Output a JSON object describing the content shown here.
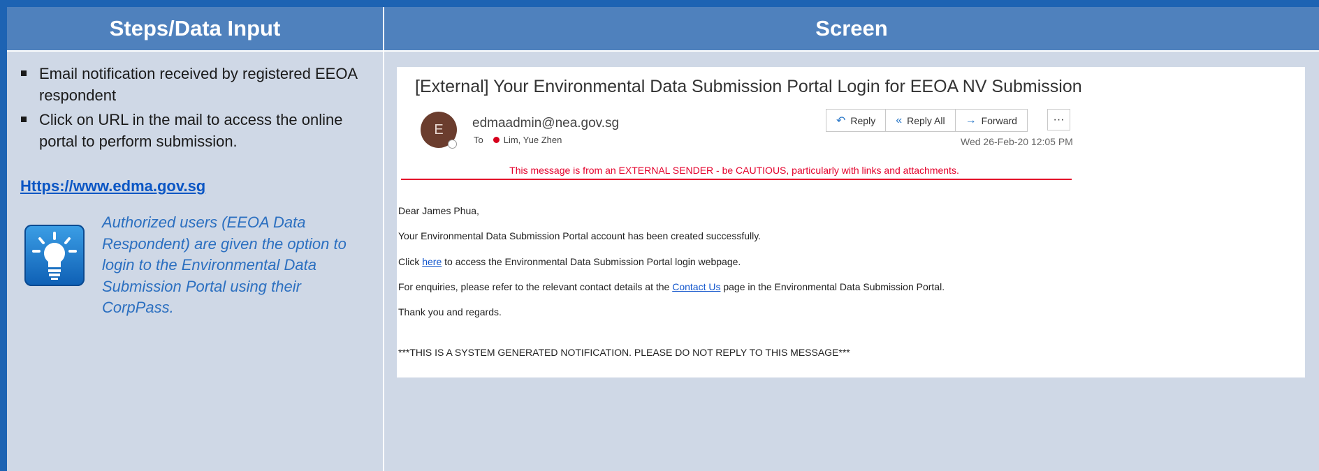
{
  "headers": {
    "left": "Steps/Data Input",
    "right": "Screen"
  },
  "left": {
    "bullets": [
      "Email notification received by registered EEOA respondent",
      "Click on URL in the mail to access the online portal to perform submission."
    ],
    "link": "Https://www.edma.gov.sg",
    "tip_icon": "lightbulb-icon",
    "tip_text": "Authorized users (EEOA Data Respondent) are given the option to login to the Environmental Data Submission Portal using their CorpPass."
  },
  "email": {
    "subject": "[External] Your Environmental Data Submission Portal Login for EEOA NV Submission",
    "avatar_letter": "E",
    "from": "edmaadmin@nea.gov.sg",
    "to_label": "To",
    "to_name": "Lim, Yue Zhen",
    "actions": {
      "reply": "Reply",
      "reply_all": "Reply All",
      "forward": "Forward",
      "more": "···"
    },
    "date": "Wed 26-Feb-20 12:05 PM",
    "warning": "This message is from an EXTERNAL SENDER - be CAUTIOUS, particularly with links and attachments.",
    "greeting": "Dear James Phua,",
    "line1": "Your Environmental Data Submission Portal account has been created successfully.",
    "line2_pre": "Click ",
    "line2_link": "here",
    "line2_post": " to access the Environmental Data Submission Portal login webpage.",
    "line3_pre": "For enquiries, please refer to the relevant contact details at the ",
    "line3_link": "Contact Us",
    "line3_post": " page in the Environmental Data Submission Portal.",
    "closing": "Thank you and regards.",
    "notice": "***THIS IS A SYSTEM GENERATED NOTIFICATION. PLEASE DO NOT REPLY TO THIS MESSAGE***"
  }
}
